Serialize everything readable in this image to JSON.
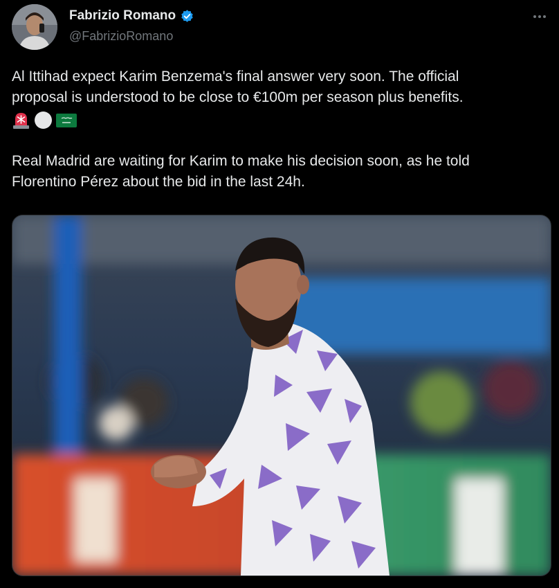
{
  "author": {
    "display_name": "Fabrizio Romano",
    "handle": "@FabrizioRomano",
    "verified": true
  },
  "tweet": {
    "paragraph_1_line_1": "Al Ittihad expect Karim Benzema's final answer very soon. The official",
    "paragraph_1_line_2": "proposal is understood to be close to €100m per season plus benefits.",
    "emojis": [
      "rotating-light-emoji",
      "white-circle-emoji",
      "saudi-arabia-flag-emoji"
    ],
    "paragraph_2_line_1": "Real Madrid are waiting for Karim to make his decision soon, as he told",
    "paragraph_2_line_2": "Florentino Pérez about the bid in the last 24h."
  },
  "colors": {
    "background": "#000000",
    "text": "#e7e9ea",
    "secondary_text": "#71767b",
    "verified_badge": "#1d9bf0"
  },
  "icons": [
    "verified-badge-icon",
    "more-options-icon"
  ]
}
